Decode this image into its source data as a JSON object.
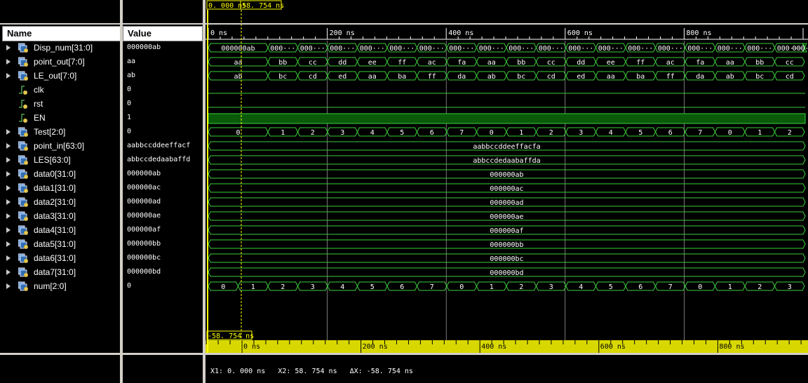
{
  "headers": {
    "name": "Name",
    "value": "Value"
  },
  "cursors": {
    "x1_label": "0. 000 ns",
    "x2_label": "58. 754 ns",
    "delta_label": "-58. 754 ns"
  },
  "status": {
    "x1": "X1: 0. 000 ns",
    "x2": "X2: 58. 754 ns",
    "dx": "ΔX: -58. 754 ns"
  },
  "timeline": {
    "top_ticks": [
      "0 ns",
      "200 ns",
      "400 ns",
      "600 ns",
      "800 ns"
    ],
    "bottom_ticks": [
      "0 ns",
      "200 ns",
      "400 ns",
      "600 ns",
      "800 ns"
    ]
  },
  "signals": [
    {
      "name": "Disp_num[31:0]",
      "value": "000000ab",
      "icon": "bus-icon",
      "expandable": true,
      "kind": "bus",
      "first": "000000ab",
      "segs": [
        "000···",
        "000···",
        "000···",
        "000···",
        "000···",
        "000···",
        "000···",
        "000···",
        "000···",
        "000···",
        "000···",
        "000···",
        "000···",
        "000···",
        "000···",
        "000···",
        "000···",
        "000···",
        "000···"
      ]
    },
    {
      "name": "point_out[7:0]",
      "value": "aa",
      "icon": "bus-icon",
      "expandable": true,
      "kind": "bus",
      "first": "aa",
      "segs": [
        "bb",
        "cc",
        "dd",
        "ee",
        "ff",
        "ac",
        "fa",
        "aa",
        "bb",
        "cc",
        "dd",
        "ee",
        "ff",
        "ac",
        "fa",
        "aa",
        "bb",
        "cc"
      ]
    },
    {
      "name": "LE_out[7:0]",
      "value": "ab",
      "icon": "bus-icon",
      "expandable": true,
      "kind": "bus",
      "first": "ab",
      "segs": [
        "bc",
        "cd",
        "ed",
        "aa",
        "ba",
        "ff",
        "da",
        "ab",
        "bc",
        "cd",
        "ed",
        "aa",
        "ba",
        "ff",
        "da",
        "ab",
        "bc",
        "cd"
      ]
    },
    {
      "name": "clk",
      "value": "0",
      "icon": "bit-icon",
      "expandable": false,
      "kind": "low"
    },
    {
      "name": "rst",
      "value": "0",
      "icon": "bit-icon",
      "expandable": false,
      "kind": "low"
    },
    {
      "name": "EN",
      "value": "1",
      "icon": "bit-icon",
      "expandable": false,
      "kind": "high"
    },
    {
      "name": "Test[2:0]",
      "value": "0",
      "icon": "bus-icon",
      "expandable": true,
      "kind": "bus",
      "first": "0",
      "segs": [
        "1",
        "2",
        "3",
        "4",
        "5",
        "6",
        "7",
        "0",
        "1",
        "2",
        "3",
        "4",
        "5",
        "6",
        "7",
        "0",
        "1",
        "2"
      ]
    },
    {
      "name": "point_in[63:0]",
      "value": "aabbccddeeffacf",
      "icon": "bus-icon",
      "expandable": true,
      "kind": "const",
      "label": "aabbccddeeffacfa"
    },
    {
      "name": "LES[63:0]",
      "value": "abbccdedaabaffd",
      "icon": "bus-icon",
      "expandable": true,
      "kind": "const",
      "label": "abbccdedaabaffda"
    },
    {
      "name": "data0[31:0]",
      "value": "000000ab",
      "icon": "bus-icon",
      "expandable": true,
      "kind": "const",
      "label": "000000ab"
    },
    {
      "name": "data1[31:0]",
      "value": "000000ac",
      "icon": "bus-icon",
      "expandable": true,
      "kind": "const",
      "label": "000000ac"
    },
    {
      "name": "data2[31:0]",
      "value": "000000ad",
      "icon": "bus-icon",
      "expandable": true,
      "kind": "const",
      "label": "000000ad"
    },
    {
      "name": "data3[31:0]",
      "value": "000000ae",
      "icon": "bus-icon",
      "expandable": true,
      "kind": "const",
      "label": "000000ae"
    },
    {
      "name": "data4[31:0]",
      "value": "000000af",
      "icon": "bus-icon",
      "expandable": true,
      "kind": "const",
      "label": "000000af"
    },
    {
      "name": "data5[31:0]",
      "value": "000000bb",
      "icon": "bus-icon",
      "expandable": true,
      "kind": "const",
      "label": "000000bb"
    },
    {
      "name": "data6[31:0]",
      "value": "000000bc",
      "icon": "bus-icon",
      "expandable": true,
      "kind": "const",
      "label": "000000bc"
    },
    {
      "name": "data7[31:0]",
      "value": "000000bd",
      "icon": "bus-icon",
      "expandable": true,
      "kind": "const",
      "label": "000000bd"
    },
    {
      "name": "num[2:0]",
      "value": "0",
      "icon": "bus-icon",
      "expandable": true,
      "kind": "bus",
      "aligned": true,
      "segs": [
        "0",
        "1",
        "2",
        "3",
        "4",
        "5",
        "6",
        "7",
        "0",
        "1",
        "2",
        "3",
        "4",
        "5",
        "6",
        "7",
        "0",
        "1",
        "2",
        "3"
      ]
    }
  ],
  "colors": {
    "wave": "#3ccc3c",
    "cursor": "#ffff00",
    "en_fill": "#0a5a0a",
    "ruler_bottom": "#d8d800"
  }
}
